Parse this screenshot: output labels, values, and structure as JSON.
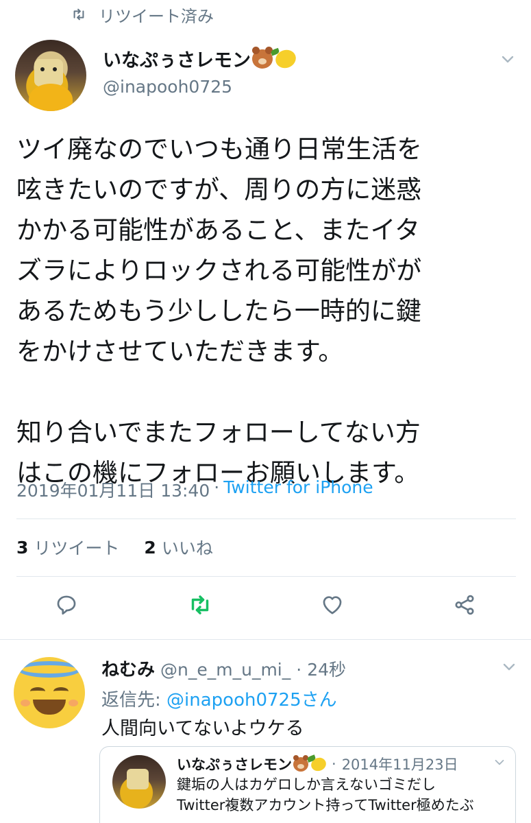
{
  "retweet_indicator": {
    "label": "リツイート済み",
    "icon": "retweet-icon"
  },
  "main_tweet": {
    "display_name": "いなぷぅさレモン",
    "emojis": [
      "bear-face-emoji",
      "lemon-emoji"
    ],
    "handle": "@inapooh0725",
    "text": "ツイ廃なのでいつも通り日常生活を\n呟きたいのですが、周りの方に迷惑\nかかる可能性があること、またイタ\nズラによりロックされる可能性がが\nあるためもう少ししたら一時的に鍵\nをかけさせていただきます。\n\n知り合いでまたフォローしてない方\nはこの機にフォローお願いします。",
    "timestamp": "2019年01月11日 13:40",
    "separator": "·",
    "source": "Twitter for iPhone",
    "retweet_count": "3",
    "retweet_label": "リツイート",
    "like_count": "2",
    "like_label": "いいね"
  },
  "actions": {
    "reply_icon": "reply-icon",
    "retweet_icon": "retweet-icon",
    "like_icon": "heart-icon",
    "share_icon": "share-icon",
    "retweet_active_color": "#17bf63",
    "icon_color": "#657786"
  },
  "reply_tweet": {
    "display_name": "ねむみ",
    "handle": "@n_e_m_u_mi_",
    "separator": "·",
    "time": "24秒",
    "reply_to_label": "返信先:",
    "reply_to_mention": "@inapooh0725さん",
    "text": "人間向いてないよウケる"
  },
  "quoted_tweet": {
    "display_name": "いなぷぅさレモン",
    "separator": "·",
    "date": "2014年11月23日",
    "text": "鍵垢の人はカゲロしか言えないゴミだし\nTwitter複数アカウント持ってTwitter極めたぶ"
  },
  "colors": {
    "text": "#14171a",
    "secondary": "#657786",
    "link": "#1da1f2",
    "divider": "#e1e8ed"
  }
}
